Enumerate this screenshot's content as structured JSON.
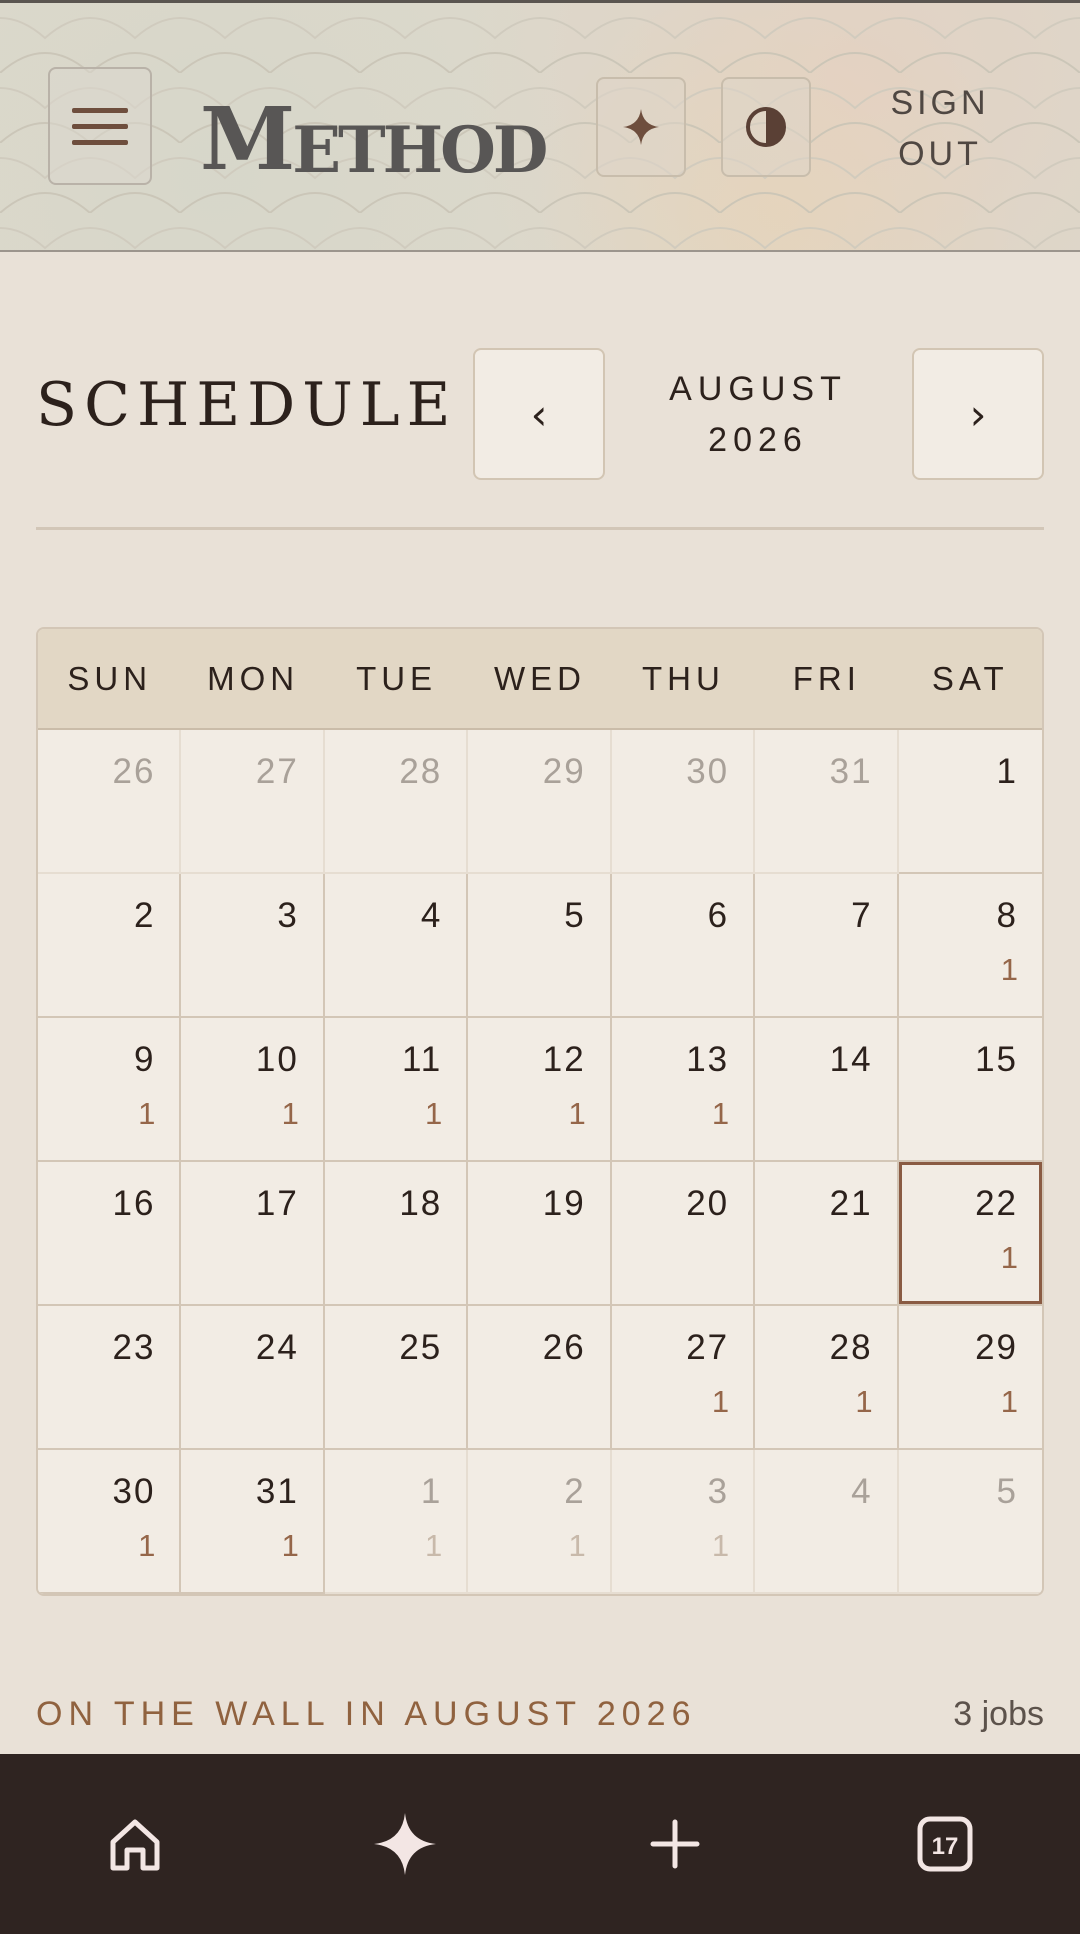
{
  "header": {
    "logo_big": "M",
    "logo_rest": "ETHOD",
    "signout_line1": "SIGN",
    "signout_line2": "OUT",
    "menu_icon": "hamburger-icon",
    "sparkle_icon": "sparkle-icon",
    "contrast_icon": "contrast-icon"
  },
  "schedule": {
    "title": "SCHEDULE",
    "prev_label": "‹",
    "next_label": "›",
    "month_line1": "AUGUST",
    "month_line2": "2026"
  },
  "calendar": {
    "weekdays": [
      "SUN",
      "MON",
      "TUE",
      "WED",
      "THU",
      "FRI",
      "SAT"
    ],
    "today": "22",
    "days": [
      {
        "n": "26",
        "c": "",
        "muted": true
      },
      {
        "n": "27",
        "c": "",
        "muted": true
      },
      {
        "n": "28",
        "c": "",
        "muted": true
      },
      {
        "n": "29",
        "c": "",
        "muted": true
      },
      {
        "n": "30",
        "c": "",
        "muted": true
      },
      {
        "n": "31",
        "c": "",
        "muted": true
      },
      {
        "n": "1",
        "c": "",
        "muted": false
      },
      {
        "n": "2",
        "c": "",
        "muted": false
      },
      {
        "n": "3",
        "c": "",
        "muted": false
      },
      {
        "n": "4",
        "c": "",
        "muted": false
      },
      {
        "n": "5",
        "c": "",
        "muted": false
      },
      {
        "n": "6",
        "c": "",
        "muted": false
      },
      {
        "n": "7",
        "c": "",
        "muted": false
      },
      {
        "n": "8",
        "c": "1",
        "muted": false
      },
      {
        "n": "9",
        "c": "1",
        "muted": false
      },
      {
        "n": "10",
        "c": "1",
        "muted": false
      },
      {
        "n": "11",
        "c": "1",
        "muted": false
      },
      {
        "n": "12",
        "c": "1",
        "muted": false
      },
      {
        "n": "13",
        "c": "1",
        "muted": false
      },
      {
        "n": "14",
        "c": "",
        "muted": false
      },
      {
        "n": "15",
        "c": "",
        "muted": false
      },
      {
        "n": "16",
        "c": "",
        "muted": false
      },
      {
        "n": "17",
        "c": "",
        "muted": false
      },
      {
        "n": "18",
        "c": "",
        "muted": false
      },
      {
        "n": "19",
        "c": "",
        "muted": false
      },
      {
        "n": "20",
        "c": "",
        "muted": false
      },
      {
        "n": "21",
        "c": "",
        "muted": false
      },
      {
        "n": "22",
        "c": "1",
        "muted": false
      },
      {
        "n": "23",
        "c": "",
        "muted": false
      },
      {
        "n": "24",
        "c": "",
        "muted": false
      },
      {
        "n": "25",
        "c": "",
        "muted": false
      },
      {
        "n": "26",
        "c": "",
        "muted": false
      },
      {
        "n": "27",
        "c": "1",
        "muted": false
      },
      {
        "n": "28",
        "c": "1",
        "muted": false
      },
      {
        "n": "29",
        "c": "1",
        "muted": false
      },
      {
        "n": "30",
        "c": "1",
        "muted": false
      },
      {
        "n": "31",
        "c": "1",
        "muted": false
      },
      {
        "n": "1",
        "c": "1",
        "muted": true
      },
      {
        "n": "2",
        "c": "1",
        "muted": true
      },
      {
        "n": "3",
        "c": "1",
        "muted": true
      },
      {
        "n": "4",
        "c": "",
        "muted": true
      },
      {
        "n": "5",
        "c": "",
        "muted": true
      }
    ]
  },
  "summary": {
    "wall_label": "ON THE WALL IN AUGUST 2026",
    "jobs_label": "3 jobs"
  },
  "bottom_nav": {
    "items": [
      {
        "icon": "home-icon"
      },
      {
        "icon": "sparkle-icon"
      },
      {
        "icon": "plus-icon"
      },
      {
        "icon": "calendar-icon",
        "badge": "17"
      }
    ]
  },
  "colors": {
    "accent": "#956649",
    "dark": "#2f2421",
    "background": "#e9e1d7"
  }
}
